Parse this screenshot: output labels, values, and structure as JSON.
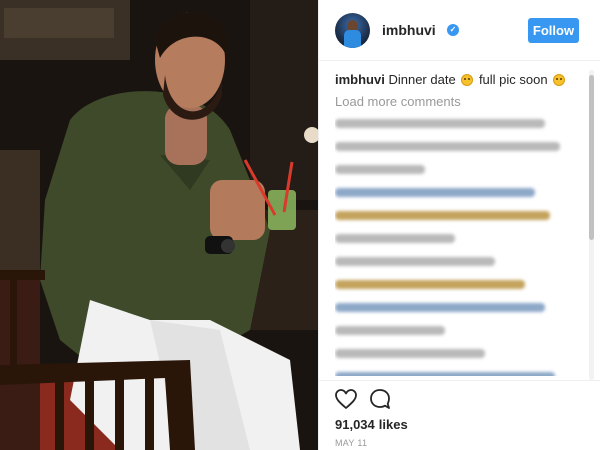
{
  "post": {
    "username": "imbhuvi",
    "follow_label": "Follow",
    "caption_user": "imbhuvi",
    "caption_text_1": "Dinner date",
    "caption_text_2": "full pic soon",
    "load_more": "Load more comments",
    "likes_count": "91,034",
    "likes_label": "likes",
    "date": "MAY 11"
  },
  "colors": {
    "follow_button": "#3897f0",
    "verified_badge": "#3897f0",
    "muted_text": "#999999"
  },
  "icons": [
    "verified-badge-icon",
    "heart-icon",
    "comment-icon",
    "smiley-emoji-icon"
  ]
}
